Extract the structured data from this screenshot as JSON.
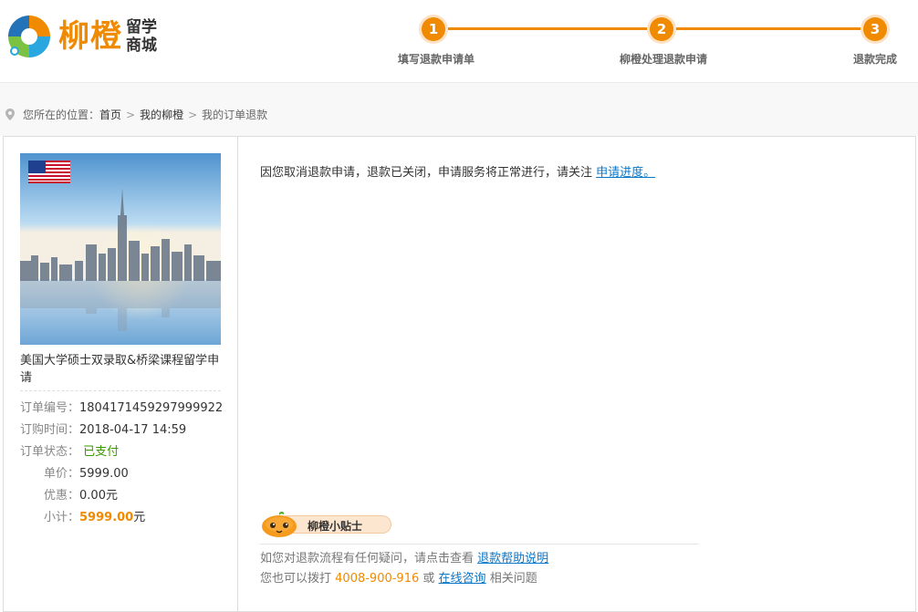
{
  "brand": {
    "name": "柳橙",
    "sub_line1": "留学",
    "sub_line2": "商城"
  },
  "steps": [
    {
      "number": "1",
      "label": "填写退款申请单"
    },
    {
      "number": "2",
      "label": "柳橙处理退款申请"
    },
    {
      "number": "3",
      "label": "退款完成"
    }
  ],
  "breadcrumb": {
    "prefix": "您所在的位置：",
    "items": [
      "首页",
      "我的柳橙",
      "我的订单退款"
    ],
    "separator": ">"
  },
  "product": {
    "title": "美国大学硕士双录取&桥梁课程留学申请",
    "order_no_label": "订单编号：",
    "order_no": "1804171459297999922",
    "order_time_label": "订购时间：",
    "order_time": "2018-04-17 14:59",
    "status_label": "订单状态：",
    "status": "已支付",
    "price_label": "单价：",
    "price": "5999.00",
    "discount_label": "优惠：",
    "discount": "0.00元",
    "subtotal_label": "小计：",
    "subtotal": "5999.00",
    "subtotal_unit": "元"
  },
  "message": {
    "text": "因您取消退款申请，退款已关闭，申请服务将正常进行，请关注",
    "link": "申请进度。"
  },
  "tips": {
    "badge": "柳橙小贴士",
    "line1_text": "如您对退款流程有任何疑问，请点击查看",
    "line1_link": "退款帮助说明",
    "line2_prefix": "您也可以拨打",
    "phone": "4008-900-916",
    "line2_or": "或",
    "line2_link": "在线咨询",
    "line2_suffix": "相关问题"
  },
  "colors": {
    "accent": "#f08a00",
    "link": "#0a77c8",
    "paid": "#3a9a00"
  }
}
